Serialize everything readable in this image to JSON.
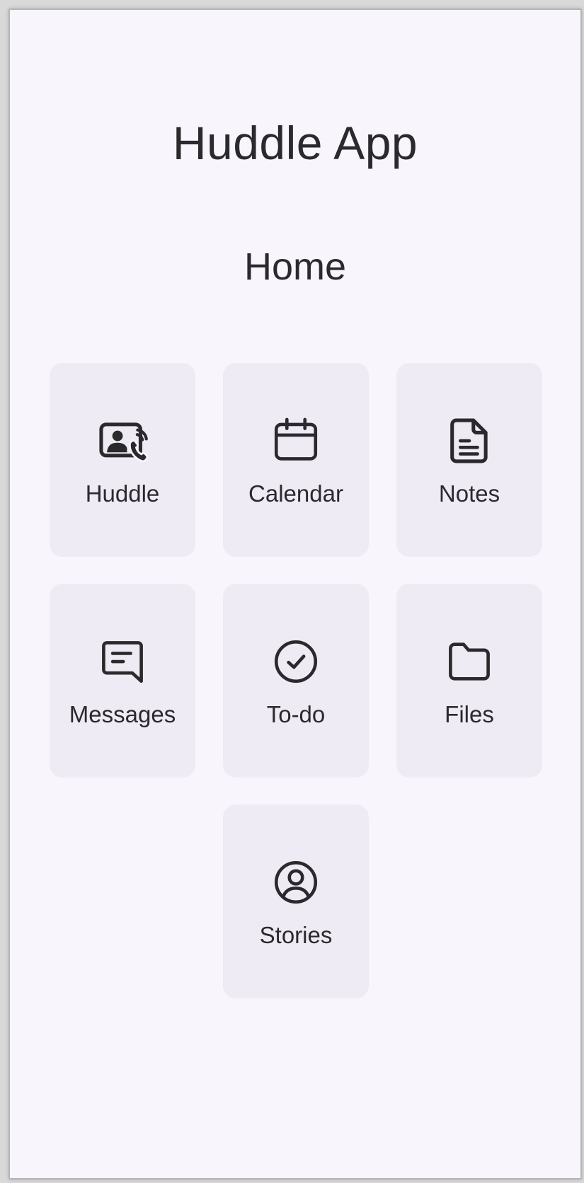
{
  "app": {
    "title": "Huddle App"
  },
  "page": {
    "title": "Home"
  },
  "tiles": [
    {
      "label": "Huddle",
      "icon": "video-call-icon"
    },
    {
      "label": "Calendar",
      "icon": "calendar-icon"
    },
    {
      "label": "Notes",
      "icon": "notes-icon"
    },
    {
      "label": "Messages",
      "icon": "message-icon"
    },
    {
      "label": "To-do",
      "icon": "check-circle-icon"
    },
    {
      "label": "Files",
      "icon": "folder-icon"
    },
    {
      "label": "Stories",
      "icon": "user-circle-icon"
    }
  ],
  "colors": {
    "background": "#f8f5fd",
    "tile": "#efebf5",
    "text": "#2a2a2d"
  }
}
